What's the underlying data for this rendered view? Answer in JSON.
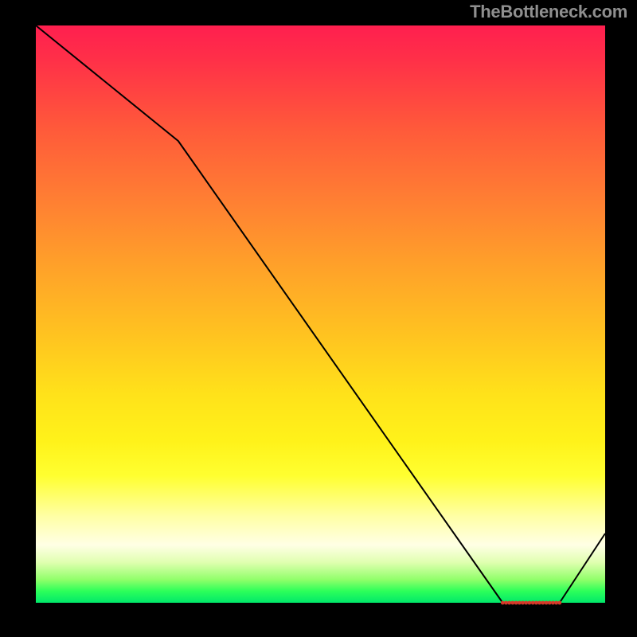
{
  "watermark": "TheBottleneck.com",
  "chart_data": {
    "type": "line",
    "title": "",
    "xlabel": "",
    "ylabel": "",
    "xlim": [
      0,
      100
    ],
    "ylim": [
      0,
      100
    ],
    "grid": false,
    "legend": false,
    "series": [
      {
        "name": "curve",
        "x": [
          0,
          25,
          82,
          92,
          100
        ],
        "values": [
          100,
          80,
          0,
          0,
          12
        ]
      }
    ],
    "flat_segment": {
      "x_start": 82,
      "x_end": 92,
      "y": 0
    },
    "markers": {
      "y": 0,
      "x_start": 82,
      "x_end": 92,
      "count": 18,
      "color": "#d43a2a",
      "radius": 2.4
    },
    "line_color": "#000000",
    "line_width": 2
  },
  "colors": {
    "background": "#000000",
    "watermark": "#8f8f8f"
  }
}
